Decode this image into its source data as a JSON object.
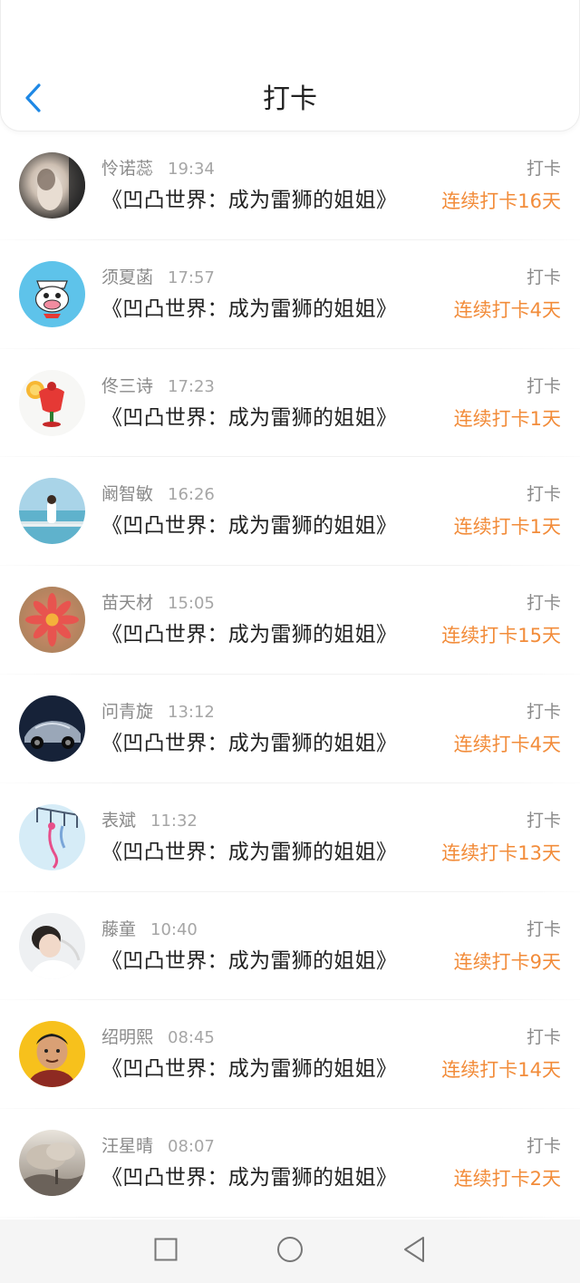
{
  "header": {
    "title": "打卡",
    "back_icon": "chevron-left-icon",
    "back_color": "#1e88e5"
  },
  "rows": [
    {
      "name": "怜诺蕊",
      "time": "19:34",
      "book": "《凹凸世界：成为雷狮的姐姐》",
      "action": "打卡",
      "streak": "连续打卡16天",
      "avatar": "photo-portrait"
    },
    {
      "name": "须夏菡",
      "time": "17:57",
      "book": "《凹凸世界：成为雷狮的姐姐》",
      "action": "打卡",
      "streak": "连续打卡4天",
      "avatar": "cartoon-monkey"
    },
    {
      "name": "佟三诗",
      "time": "17:23",
      "book": "《凹凸世界：成为雷狮的姐姐》",
      "action": "打卡",
      "streak": "连续打卡1天",
      "avatar": "drink-glass"
    },
    {
      "name": "阚智敏",
      "time": "16:26",
      "book": "《凹凸世界：成为雷狮的姐姐》",
      "action": "打卡",
      "streak": "连续打卡1天",
      "avatar": "seaside-girl"
    },
    {
      "name": "苗天材",
      "time": "15:05",
      "book": "《凹凸世界：成为雷狮的姐姐》",
      "action": "打卡",
      "streak": "连续打卡15天",
      "avatar": "pink-flower"
    },
    {
      "name": "问青旋",
      "time": "13:12",
      "book": "《凹凸世界：成为雷狮的姐姐》",
      "action": "打卡",
      "streak": "连续打卡4天",
      "avatar": "sports-car"
    },
    {
      "name": "表斌",
      "time": "11:32",
      "book": "《凹凸世界：成为雷狮的姐姐》",
      "action": "打卡",
      "streak": "连续打卡13天",
      "avatar": "wind-chime"
    },
    {
      "name": "藤童",
      "time": "10:40",
      "book": "《凹凸世界：成为雷狮的姐姐》",
      "action": "打卡",
      "streak": "连续打卡9天",
      "avatar": "boy-portrait"
    },
    {
      "name": "绍明熙",
      "time": "08:45",
      "book": "《凹凸世界：成为雷狮的姐姐》",
      "action": "打卡",
      "streak": "连续打卡14天",
      "avatar": "cartoon-man"
    },
    {
      "name": "汪星晴",
      "time": "08:07",
      "book": "《凹凸世界：成为雷狮的姐姐》",
      "action": "打卡",
      "streak": "连续打卡2天",
      "avatar": "sepia-landscape"
    }
  ],
  "colors": {
    "streak": "#f28c3a",
    "secondary_text": "#8a8a8a",
    "primary_text": "#222222"
  },
  "system_nav": {
    "recents_icon": "square-icon",
    "home_icon": "circle-icon",
    "back_icon": "triangle-back-icon"
  }
}
